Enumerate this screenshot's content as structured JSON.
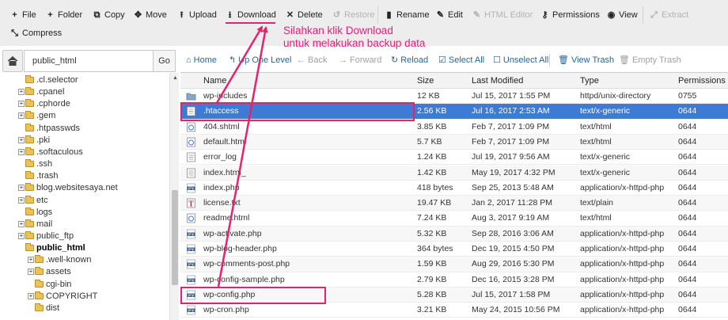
{
  "toolbar": {
    "file": "File",
    "folder": "Folder",
    "copy": "Copy",
    "move": "Move",
    "upload": "Upload",
    "download": "Download",
    "delete": "Delete",
    "restore": "Restore",
    "rename": "Rename",
    "edit": "Edit",
    "html_editor": "HTML Editor",
    "permissions": "Permissions",
    "view": "View",
    "extract": "Extract",
    "compress": "Compress"
  },
  "pathbar": {
    "path": "public_html",
    "go_label": "Go"
  },
  "file_toolbar": {
    "home": "Home",
    "up_one_level": "Up One Level",
    "back": "Back",
    "forward": "Forward",
    "reload": "Reload",
    "select_all": "Select All",
    "unselect_all": "Unselect All",
    "view_trash": "View Trash",
    "empty_trash": "Empty Trash"
  },
  "tree": [
    {
      "label": ".cl.selector",
      "expand": false
    },
    {
      "label": ".cpanel",
      "expand": true
    },
    {
      "label": ".cphorde",
      "expand": true
    },
    {
      "label": ".gem",
      "expand": true
    },
    {
      "label": ".htpasswds",
      "expand": false
    },
    {
      "label": ".pki",
      "expand": true
    },
    {
      "label": ".softaculous",
      "expand": true
    },
    {
      "label": ".ssh",
      "expand": false
    },
    {
      "label": ".trash",
      "expand": false
    },
    {
      "label": "blog.websitesaya.net",
      "expand": true
    },
    {
      "label": "etc",
      "expand": true
    },
    {
      "label": "logs",
      "expand": false
    },
    {
      "label": "mail",
      "expand": true
    },
    {
      "label": "public_ftp",
      "expand": true
    },
    {
      "label": "public_html",
      "expand": false,
      "bold": true
    },
    {
      "label": ".well-known",
      "expand": true,
      "child": true
    },
    {
      "label": "assets",
      "expand": true,
      "child": true
    },
    {
      "label": "cgi-bin",
      "expand": false,
      "child": true
    },
    {
      "label": "COPYRIGHT",
      "expand": true,
      "child": true
    },
    {
      "label": "dist",
      "expand": false,
      "child": true
    }
  ],
  "table": {
    "headers": {
      "name": "Name",
      "size": "Size",
      "modified": "Last Modified",
      "type": "Type",
      "perms": "Permissions"
    },
    "rows": [
      {
        "icon": "folder",
        "name": "wp-includes",
        "size": "12 KB",
        "modified": "Jul 15, 2017 1:55 PM",
        "type": "httpd/unix-directory",
        "perms": "0755"
      },
      {
        "icon": "text",
        "name": ".htaccess",
        "size": "2.56 KB",
        "modified": "Jul 16, 2017 2:53 AM",
        "type": "text/x-generic",
        "perms": "0644",
        "selected": true
      },
      {
        "icon": "html",
        "name": "404.shtml",
        "size": "3.85 KB",
        "modified": "Feb 7, 2017 1:09 PM",
        "type": "text/html",
        "perms": "0644"
      },
      {
        "icon": "html",
        "name": "default.html",
        "size": "5.7 KB",
        "modified": "Feb 7, 2017 1:09 PM",
        "type": "text/html",
        "perms": "0644"
      },
      {
        "icon": "text",
        "name": "error_log",
        "size": "1.24 KB",
        "modified": "Jul 19, 2017 9:56 AM",
        "type": "text/x-generic",
        "perms": "0644"
      },
      {
        "icon": "text",
        "name": "index.html_",
        "size": "1.42 KB",
        "modified": "May 19, 2017 4:32 PM",
        "type": "text/x-generic",
        "perms": "0644"
      },
      {
        "icon": "php",
        "name": "index.php",
        "size": "418 bytes",
        "modified": "Sep 25, 2013 5:48 AM",
        "type": "application/x-httpd-php",
        "perms": "0644"
      },
      {
        "icon": "txt",
        "name": "license.txt",
        "size": "19.47 KB",
        "modified": "Jan 2, 2017 11:28 PM",
        "type": "text/plain",
        "perms": "0644"
      },
      {
        "icon": "html",
        "name": "readme.html",
        "size": "7.24 KB",
        "modified": "Aug 3, 2017 9:19 AM",
        "type": "text/html",
        "perms": "0644"
      },
      {
        "icon": "php",
        "name": "wp-activate.php",
        "size": "5.32 KB",
        "modified": "Sep 28, 2016 3:06 AM",
        "type": "application/x-httpd-php",
        "perms": "0644"
      },
      {
        "icon": "php",
        "name": "wp-blog-header.php",
        "size": "364 bytes",
        "modified": "Dec 19, 2015 4:50 PM",
        "type": "application/x-httpd-php",
        "perms": "0644"
      },
      {
        "icon": "php",
        "name": "wp-comments-post.php",
        "size": "1.59 KB",
        "modified": "Aug 29, 2016 5:30 PM",
        "type": "application/x-httpd-php",
        "perms": "0644"
      },
      {
        "icon": "php",
        "name": "wp-config-sample.php",
        "size": "2.79 KB",
        "modified": "Dec 16, 2015 3:28 PM",
        "type": "application/x-httpd-php",
        "perms": "0644"
      },
      {
        "icon": "php",
        "name": "wp-config.php",
        "size": "5.28 KB",
        "modified": "Jul 15, 2017 1:58 PM",
        "type": "application/x-httpd-php",
        "perms": "0644"
      },
      {
        "icon": "php",
        "name": "wp-cron.php",
        "size": "3.21 KB",
        "modified": "May 24, 2015 10:56 PM",
        "type": "application/x-httpd-php",
        "perms": "0644"
      }
    ]
  },
  "annotation": {
    "line1": "Silahkan klik Download",
    "line2": "untuk melakukan backup data",
    "color": "#e2246f"
  }
}
